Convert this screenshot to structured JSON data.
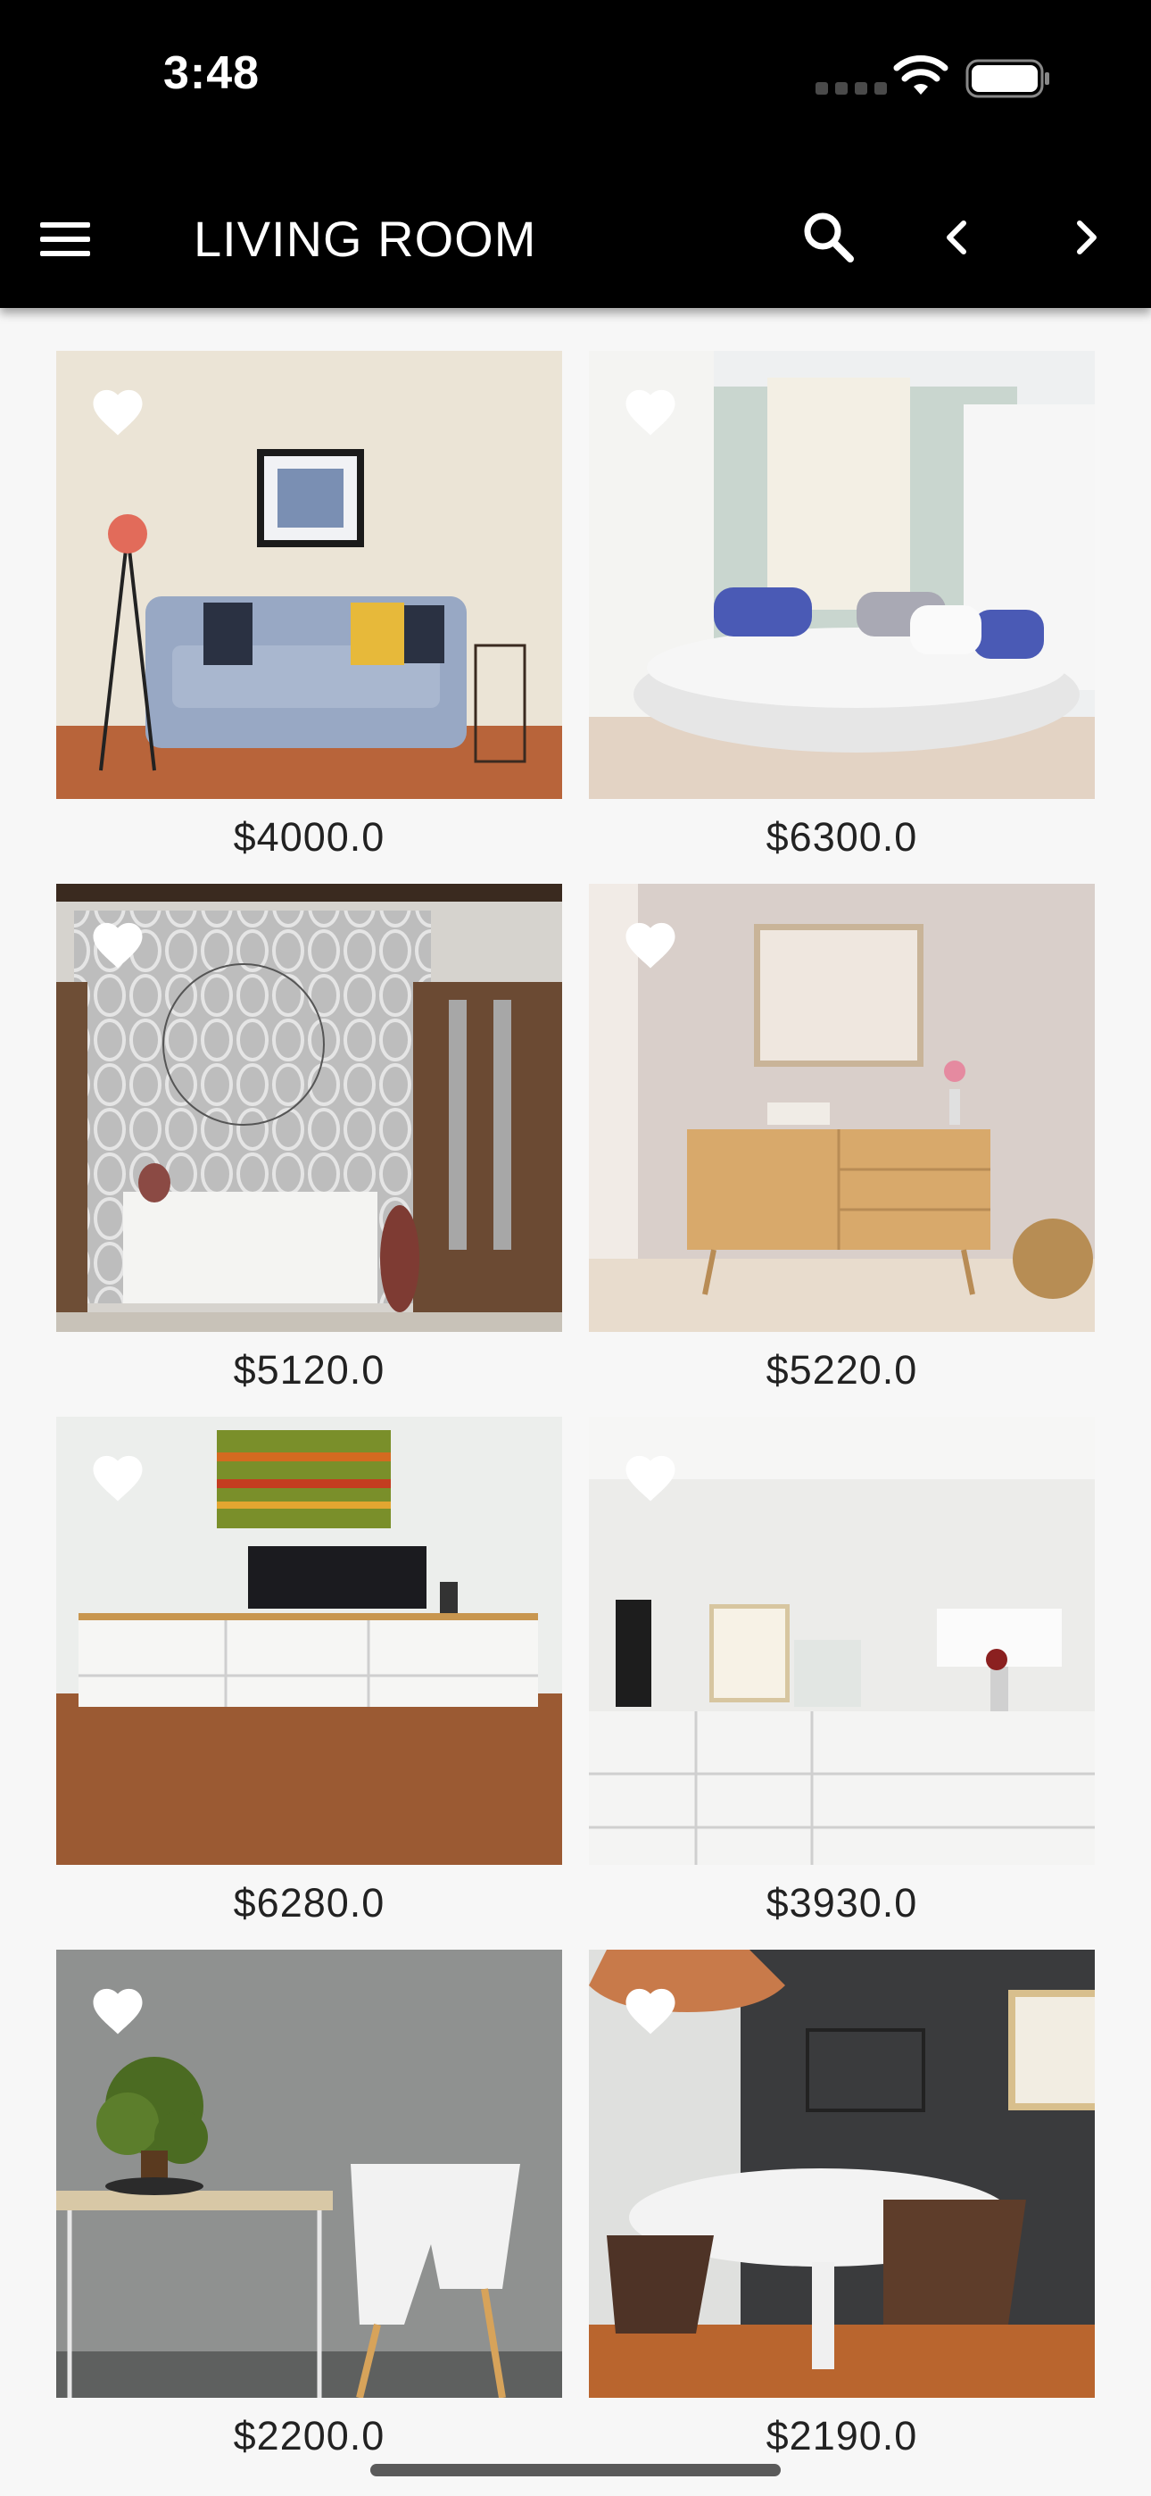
{
  "status_bar": {
    "time": "3:48"
  },
  "app_bar": {
    "title": "LIVING ROOM",
    "menu_icon": "hamburger-menu-icon",
    "search_icon": "search-icon",
    "prev_icon": "chevron-left-icon",
    "next_icon": "chevron-right-icon"
  },
  "products": [
    {
      "price": "$4000.0"
    },
    {
      "price": "$6300.0"
    },
    {
      "price": "$5120.0"
    },
    {
      "price": "$5220.0"
    },
    {
      "price": "$6280.0"
    },
    {
      "price": "$3930.0"
    },
    {
      "price": "$2200.0"
    },
    {
      "price": "$2190.0"
    }
  ],
  "colors": {
    "bar": "#000000",
    "background": "#f7f7f7",
    "price_text": "#222222"
  }
}
